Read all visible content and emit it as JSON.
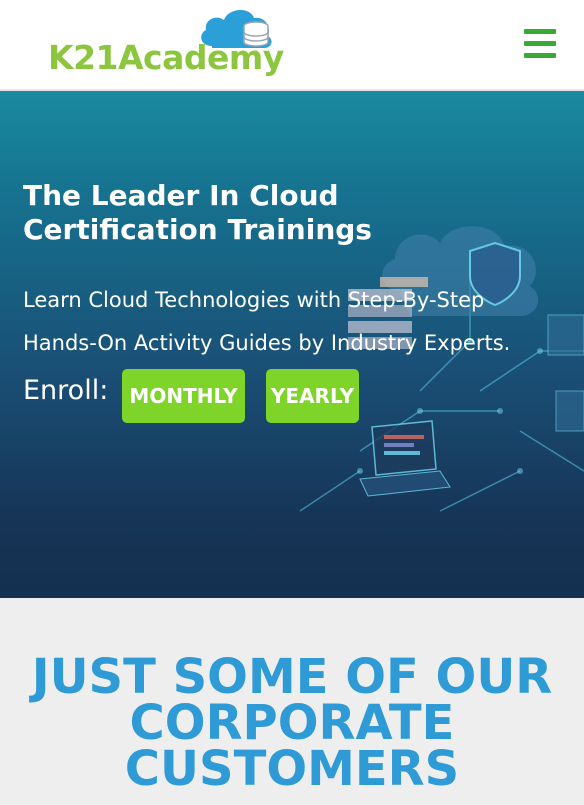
{
  "header": {
    "logo_text": "K21Academy",
    "menu_icon": "hamburger-menu-icon",
    "colors": {
      "logo_green": "#8cc63f",
      "logo_cloud_blue": "#2b9fd8",
      "menu_green": "#3aa935"
    }
  },
  "hero": {
    "title": "The Leader In Cloud Certification Trainings",
    "subtitle": "Learn Cloud Technologies with Step-By-Step Hands-On Activity Guides by Industry Experts.",
    "enroll_label": "Enroll:",
    "buttons": {
      "monthly": "MONTHLY",
      "yearly": "YEARLY"
    },
    "illustration": "cloud-network-illustration",
    "colors": {
      "button_green": "#7fd42a",
      "bg_top": "#1a8aa0",
      "bg_bottom": "#14304f"
    }
  },
  "customers": {
    "heading": "JUST SOME OF OUR CORPORATE CUSTOMERS",
    "colors": {
      "heading_blue": "#2e9bd6",
      "bg": "#eeeeee"
    }
  }
}
